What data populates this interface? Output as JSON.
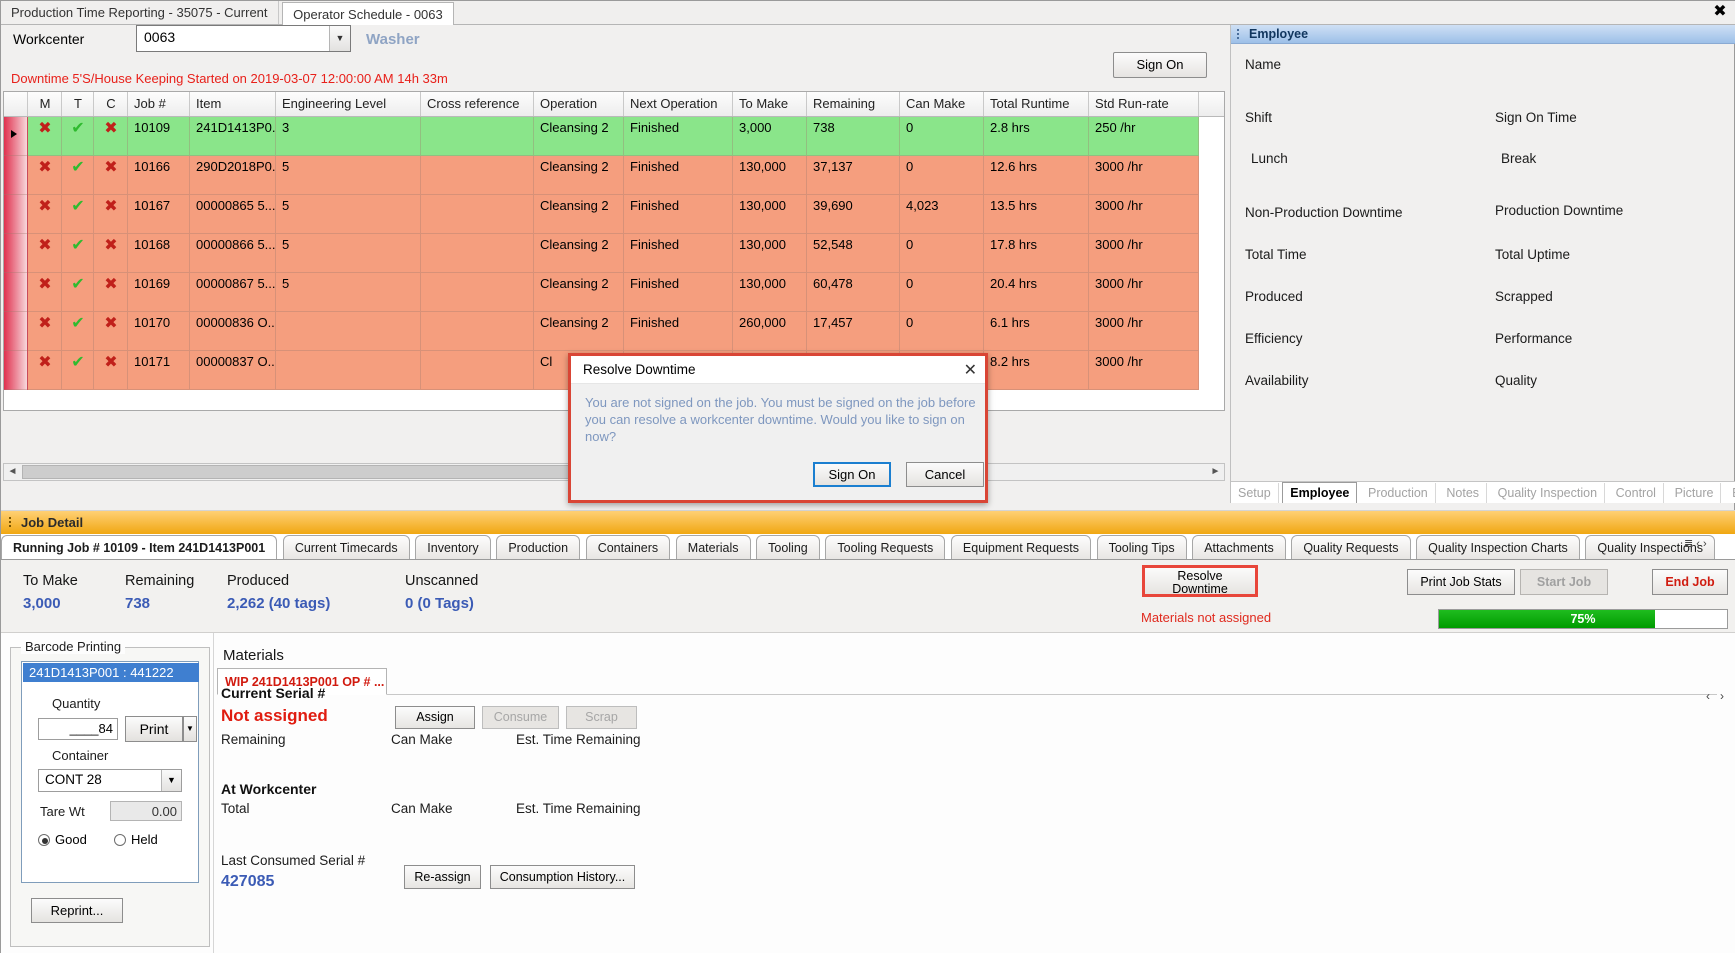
{
  "window": {
    "tabs": [
      {
        "label": "Production Time Reporting - 35075 - Current",
        "active": false
      },
      {
        "label": "Operator Schedule - 0063",
        "active": true
      }
    ],
    "close_glyph": "✖"
  },
  "toolbar": {
    "workcenter_label": "Workcenter",
    "workcenter_value": "0063",
    "workcenter_name": "Washer",
    "sign_on_label": "Sign On",
    "downtime_message": "Downtime 5'S/House Keeping Started on 2019-03-07 12:00:00 AM 14h 33m"
  },
  "grid": {
    "columns": [
      "M",
      "T",
      "C",
      "Job #",
      "Item",
      "Engineering Level",
      "Cross reference",
      "Operation",
      "Next Operation",
      "To Make",
      "Remaining",
      "Can Make",
      "Total Runtime",
      "Std Run-rate"
    ],
    "rows": [
      {
        "m": "✖",
        "t": "✔",
        "c": "✖",
        "job": "10109",
        "item": "241D1413P0...",
        "eng": "3",
        "xref": "",
        "op": "Cleansing 2",
        "nop": "Finished",
        "tomake": "3,000",
        "remaining": "738",
        "canmake": "0",
        "runtime": "2.8 hrs",
        "rate": "250 /hr",
        "state": "green"
      },
      {
        "m": "✖",
        "t": "✔",
        "c": "✖",
        "job": "10166",
        "item": "290D2018P0...",
        "eng": "5",
        "xref": "",
        "op": "Cleansing 2",
        "nop": "Finished",
        "tomake": "130,000",
        "remaining": "37,137",
        "canmake": "0",
        "runtime": "12.6 hrs",
        "rate": "3000 /hr",
        "state": "salmon"
      },
      {
        "m": "✖",
        "t": "✔",
        "c": "✖",
        "job": "10167",
        "item": "00000865  5...",
        "eng": "5",
        "xref": "",
        "op": "Cleansing 2",
        "nop": "Finished",
        "tomake": "130,000",
        "remaining": "39,690",
        "canmake": "4,023",
        "runtime": "13.5 hrs",
        "rate": "3000 /hr",
        "state": "salmon"
      },
      {
        "m": "✖",
        "t": "✔",
        "c": "✖",
        "job": "10168",
        "item": "00000866  5...",
        "eng": "5",
        "xref": "",
        "op": "Cleansing 2",
        "nop": "Finished",
        "tomake": "130,000",
        "remaining": "52,548",
        "canmake": "0",
        "runtime": "17.8 hrs",
        "rate": "3000 /hr",
        "state": "salmon"
      },
      {
        "m": "✖",
        "t": "✔",
        "c": "✖",
        "job": "10169",
        "item": "00000867  5...",
        "eng": "5",
        "xref": "",
        "op": "Cleansing 2",
        "nop": "Finished",
        "tomake": "130,000",
        "remaining": "60,478",
        "canmake": "0",
        "runtime": "20.4 hrs",
        "rate": "3000 /hr",
        "state": "salmon"
      },
      {
        "m": "✖",
        "t": "✔",
        "c": "✖",
        "job": "10170",
        "item": "00000836  O...",
        "eng": "",
        "xref": "",
        "op": "Cleansing 2",
        "nop": "Finished",
        "tomake": "260,000",
        "remaining": "17,457",
        "canmake": "0",
        "runtime": "6.1 hrs",
        "rate": "3000 /hr",
        "state": "salmon"
      },
      {
        "m": "✖",
        "t": "✔",
        "c": "✖",
        "job": "10171",
        "item": "00000837  O...",
        "eng": "",
        "xref": "",
        "op": "Cl",
        "nop": "",
        "tomake": "",
        "remaining": "",
        "canmake": "",
        "runtime": "8.2 hrs",
        "rate": "3000 /hr",
        "state": "salmon"
      }
    ]
  },
  "employee_panel": {
    "header": "Employee",
    "fields": [
      {
        "label": "Name"
      },
      {
        "label": "Shift"
      },
      {
        "label": "Sign On Time"
      },
      {
        "label": "Lunch"
      },
      {
        "label": "Break"
      },
      {
        "label": "Non-Production Downtime"
      },
      {
        "label": "Production Downtime"
      },
      {
        "label": "Total Time"
      },
      {
        "label": "Total Uptime"
      },
      {
        "label": "Produced"
      },
      {
        "label": "Scrapped"
      },
      {
        "label": "Efficiency"
      },
      {
        "label": "Performance"
      },
      {
        "label": "Availability"
      },
      {
        "label": "Quality"
      }
    ],
    "tabs": [
      {
        "label": "Setup",
        "active": false
      },
      {
        "label": "Employee",
        "active": true
      },
      {
        "label": "Production",
        "active": false
      },
      {
        "label": "Notes",
        "active": false
      },
      {
        "label": "Quality Inspection",
        "active": false
      },
      {
        "label": "Control",
        "active": false
      },
      {
        "label": "Picture",
        "active": false
      },
      {
        "label": "Equipment",
        "active": false
      }
    ]
  },
  "dialog": {
    "title": "Resolve Downtime",
    "close_glyph": "✕",
    "message": "You are not signed on the job. You must be signed on the job before you can resolve a workcenter downtime. Would you like to sign on now?",
    "primary_label": "Sign On",
    "cancel_label": "Cancel"
  },
  "job_detail": {
    "header": "Job Detail",
    "tabs": [
      {
        "label": "Running Job # 10109 - Item 241D1413P001",
        "active": true
      },
      {
        "label": "Current Timecards",
        "active": false
      },
      {
        "label": "Inventory",
        "active": false
      },
      {
        "label": "Production",
        "active": false
      },
      {
        "label": "Containers",
        "active": false
      },
      {
        "label": "Materials",
        "active": false
      },
      {
        "label": "Tooling",
        "active": false
      },
      {
        "label": "Tooling Requests",
        "active": false
      },
      {
        "label": "Equipment Requests",
        "active": false
      },
      {
        "label": "Tooling Tips",
        "active": false
      },
      {
        "label": "Attachments",
        "active": false
      },
      {
        "label": "Quality Requests",
        "active": false
      },
      {
        "label": "Quality Inspection Charts",
        "active": false
      },
      {
        "label": "Quality Inspections",
        "active": false
      }
    ],
    "stats": [
      {
        "label": "To Make",
        "value": "3,000"
      },
      {
        "label": "Remaining",
        "value": "738"
      },
      {
        "label": "Produced",
        "value": "2,262 (40 tags)"
      },
      {
        "label": "Unscanned",
        "value": "0 (0 Tags)"
      }
    ],
    "resolve_downtime_label": "Resolve\nDowntime",
    "resolve_downtime_line1": "Resolve",
    "resolve_downtime_line2": "Downtime",
    "materials_warning": "Materials not assigned",
    "print_job_stats_label": "Print Job Stats",
    "start_job_label": "Start Job",
    "end_job_label": "End Job",
    "progress_percent": "75%",
    "progress_value": 75
  },
  "barcode": {
    "legend": "Barcode Printing",
    "item_title": "241D1413P001 : 441222",
    "quantity_label": "Quantity",
    "quantity_value": "____84",
    "print_label": "Print",
    "dropdown_glyph": "▼",
    "container_label": "Container",
    "container_value": "CONT 28",
    "tare_label": "Tare Wt",
    "tare_value": "0.00",
    "good_label": "Good",
    "held_label": "Held",
    "reprint_label": "Reprint..."
  },
  "materials": {
    "title": "Materials",
    "tab_label": "WIP 241D1413P001 OP # ...",
    "current_serial_label": "Current Serial #",
    "current_serial_value": "Not assigned",
    "remaining_label": "Remaining",
    "can_make_label": "Can Make",
    "est_time_label": "Est. Time Remaining",
    "at_workcenter_label": "At Workcenter",
    "total_label": "Total",
    "at_wc_can_make_label": "Can Make",
    "at_wc_est_time_label": "Est. Time Remaining",
    "last_consumed_label": "Last Consumed Serial #",
    "last_consumed_value": "427085",
    "assign_label": "Assign",
    "consume_label": "Consume",
    "scrap_label": "Scrap",
    "reassign_label": "Re-assign",
    "history_label": "Consumption History...",
    "nav_prev": "‹",
    "nav_next": "›"
  },
  "scrollbar": {
    "left_arrow": "◄",
    "right_arrow": "►"
  },
  "colors": {
    "accent_blue": "#3f7fd0",
    "alert_red": "#e02a1e",
    "row_green": "#8ae58a",
    "row_salmon": "#f59e7e",
    "progress_green": "#00a000",
    "job_bar_orange": "#f0a712"
  }
}
